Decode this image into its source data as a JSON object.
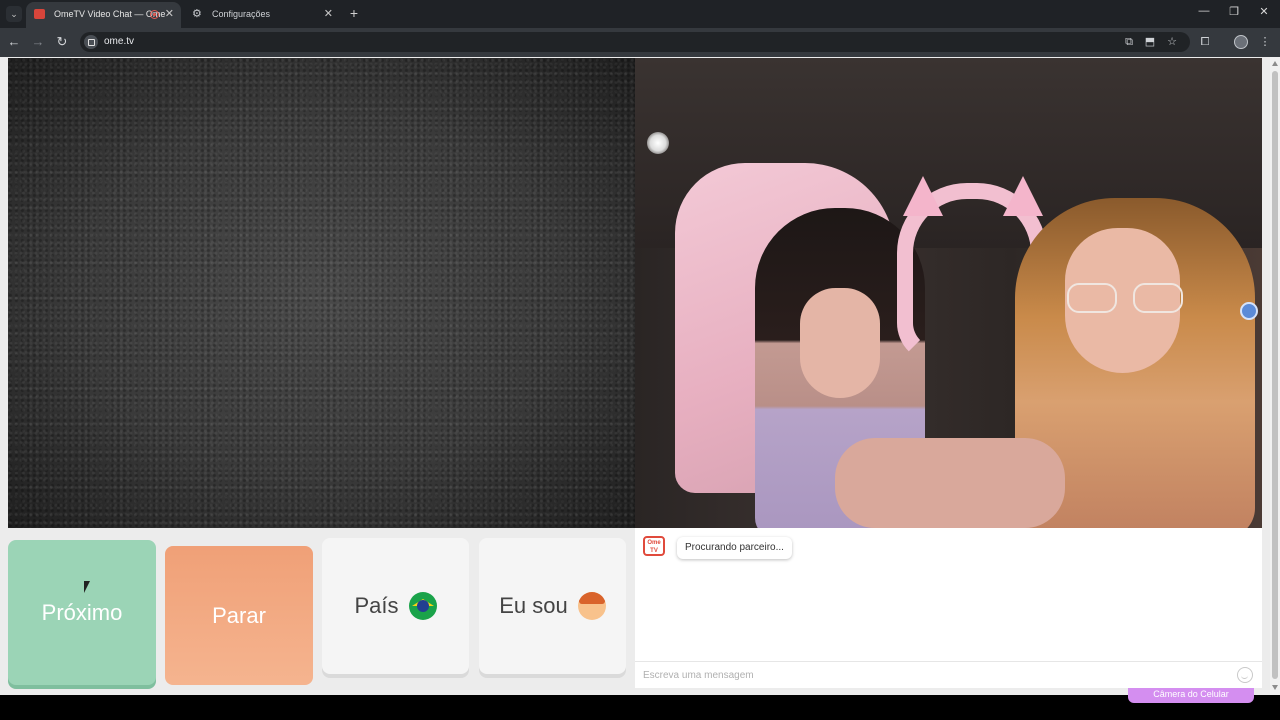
{
  "browser": {
    "tabs": [
      {
        "title": "OmeTV Video Chat — Ome",
        "active": true
      },
      {
        "title": "Configurações",
        "active": false
      }
    ],
    "url": "ome.tv",
    "icons": {
      "tab_menu": "chevron-down-icon",
      "new_tab": "plus-icon",
      "back": "arrow-left-icon",
      "forward": "arrow-right-icon",
      "reload": "reload-icon",
      "translate": "translate-icon",
      "install": "install-app-icon",
      "bookmark": "star-icon",
      "extensions": "puzzle-icon",
      "menu": "kebab-menu-icon"
    }
  },
  "controls": {
    "next_label": "Próximo",
    "stop_label": "Parar",
    "country_label": "País",
    "gender_label": "Eu sou"
  },
  "chat": {
    "logo_text": "Ome TV",
    "status_message": "Procurando parceiro...",
    "input_placeholder": "Escreva uma mensagem"
  },
  "overlay": {
    "camera_button": "Câmera do Celular"
  },
  "colors": {
    "next": "#9bd4b6",
    "stop": "#f0a077",
    "neutral": "#f5f5f5",
    "brand_red": "#e04a3c",
    "camera_purple": "#d48ef0"
  }
}
